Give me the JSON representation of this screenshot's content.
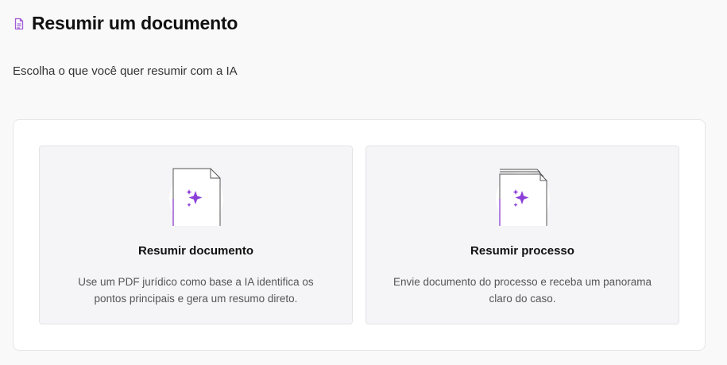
{
  "header": {
    "icon": "document-icon",
    "title": "Resumir um documento"
  },
  "subtitle": "Escolha o que você quer resumir com a IA",
  "colors": {
    "accent": "#8b3fd9",
    "icon_purple": "#a15dd6"
  },
  "options": [
    {
      "icon": "document-sparkle-icon",
      "title": "Resumir documento",
      "description": "Use um PDF jurídico como base a IA identifica os pontos principais e gera um resumo direto."
    },
    {
      "icon": "stacked-documents-sparkle-icon",
      "title": "Resumir processo",
      "description": "Envie documento do processo e receba um panorama claro do caso."
    }
  ]
}
